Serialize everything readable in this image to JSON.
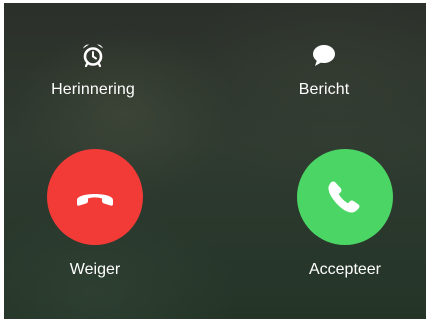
{
  "actions": {
    "reminder": {
      "label": "Herinnering",
      "icon": "alarm-clock-icon"
    },
    "message": {
      "label": "Bericht",
      "icon": "speech-bubble-icon"
    }
  },
  "call": {
    "decline": {
      "label": "Weiger",
      "icon": "phone-hangup-icon",
      "color": "#f23b37"
    },
    "accept": {
      "label": "Accepteer",
      "icon": "phone-icon",
      "color": "#4bd565"
    }
  }
}
